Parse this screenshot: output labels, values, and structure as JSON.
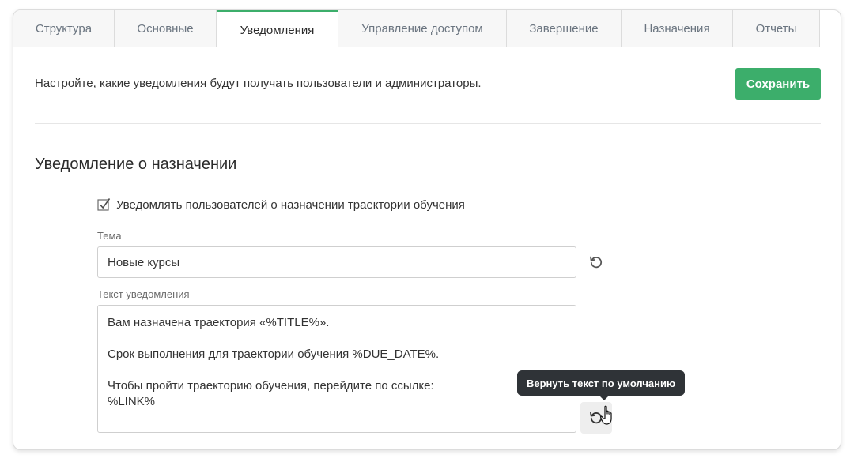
{
  "tabs": [
    {
      "label": "Структура",
      "active": false
    },
    {
      "label": "Основные",
      "active": false
    },
    {
      "label": "Уведомления",
      "active": true
    },
    {
      "label": "Управление доступом",
      "active": false
    },
    {
      "label": "Завершение",
      "active": false
    },
    {
      "label": "Назначения",
      "active": false
    },
    {
      "label": "Отчеты",
      "active": false
    }
  ],
  "intro_text": "Настройте, какие уведомления будут получать пользователи и администраторы.",
  "save_label": "Сохранить",
  "section_title": "Уведомление о назначении",
  "notify_checkbox": {
    "label": "Уведомлять пользователей о назначении траектории обучения",
    "checked": true
  },
  "subject": {
    "label": "Тема",
    "value": "Новые курсы"
  },
  "message": {
    "label": "Текст уведомления",
    "value": "Вам назначена траектория «%TITLE%».\n\nСрок выполнения для траектории обучения %DUE_DATE%.\n\nЧтобы пройти траекторию обучения, перейдите по ссылке:\n%LINK%"
  },
  "tooltip": "Вернуть текст по умолчанию",
  "colors": {
    "accent": "#3cae6b",
    "tooltip_bg": "#2f3337"
  },
  "icons": {
    "reset": "reset-icon",
    "check": "checkmark-icon",
    "cursor": "hand-pointer-icon"
  }
}
